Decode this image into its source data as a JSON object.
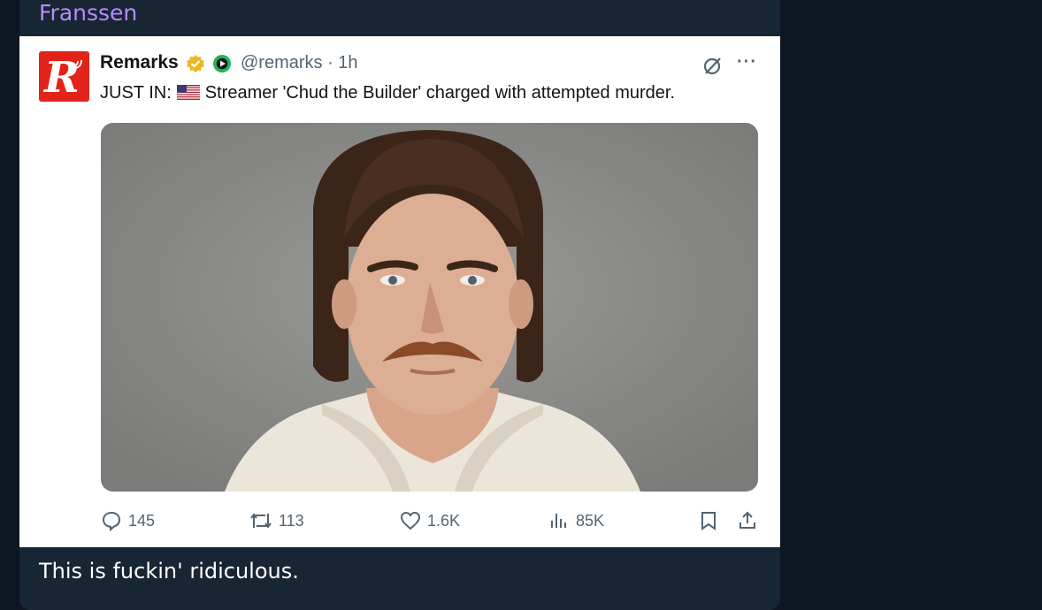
{
  "message": {
    "sender": "Franssen",
    "caption": "This is fuckin' ridiculous."
  },
  "tweet": {
    "avatar_letter": "R",
    "display_name": "Remarks",
    "handle_time": "@remarks · 1h",
    "text_prefix": "JUST IN:",
    "text_body": "Streamer 'Chud the Builder' charged with attempted murder.",
    "icons": {
      "verified": "verified-badge-icon",
      "affiliate": "affiliate-badge-icon",
      "grok": "grok-icon",
      "more": "more-options-icon",
      "flag": "us-flag-icon"
    },
    "actions": {
      "replies": "145",
      "reposts": "113",
      "likes": "1.6K",
      "views": "85K"
    }
  },
  "colors": {
    "background": "#0e1621",
    "bubble": "#182533",
    "sender_name": "#b58cff",
    "avatar_red": "#e2231a",
    "verified_gold": "#e8b829",
    "affiliate_green": "#1db954",
    "muted": "#536471"
  }
}
